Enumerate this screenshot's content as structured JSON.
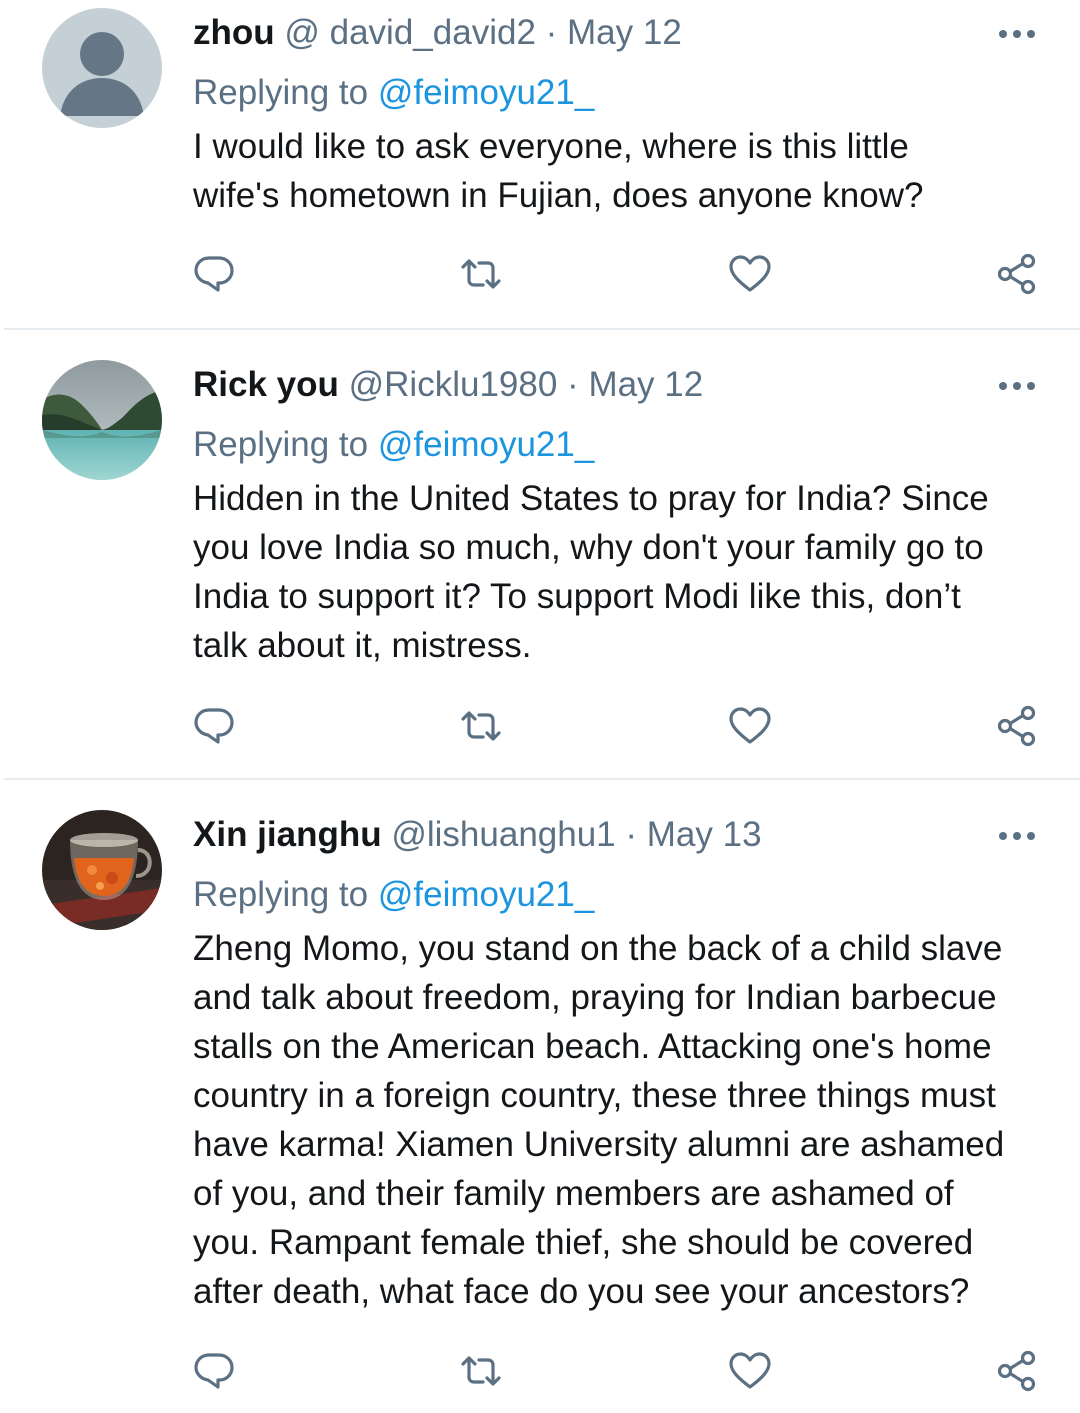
{
  "colors": {
    "name": "#14171a",
    "secondary": "#5b7083",
    "link": "#1b95e0",
    "divider": "#e6ecf0"
  },
  "tweets": [
    {
      "name": "zhou",
      "handle": "@ david_david2",
      "separator": "·",
      "date": "May 12",
      "replying_prefix": "Replying to",
      "replying_to": "@feimoyu21_",
      "text_lines": [
        "I would like to ask everyone, where is this little",
        "wife's hometown in Fujian, does anyone know?"
      ],
      "avatar": "default-avatar",
      "icons": [
        "reply-icon",
        "retweet-icon",
        "like-icon",
        "share-icon",
        "more-icon"
      ]
    },
    {
      "name": "Rick you",
      "handle": "@Ricklu1980",
      "separator": "·",
      "date": "May 12",
      "replying_prefix": "Replying to",
      "replying_to": "@feimoyu21_",
      "text_lines": [
        "Hidden in the United States to pray for India? Since",
        "you love India so much, why don't your family go to",
        "India to support it? To support Modi like this, don’t",
        "talk about it, mistress."
      ],
      "avatar": "lake-mountain-photo",
      "icons": [
        "reply-icon",
        "retweet-icon",
        "like-icon",
        "share-icon",
        "more-icon"
      ]
    },
    {
      "name": "Xin jianghu",
      "handle": "@lishuanghu1",
      "separator": "·",
      "date": "May 13",
      "replying_prefix": "Replying to",
      "replying_to": "@feimoyu21_",
      "text_lines": [
        "Zheng Momo, you stand on the back of a child slave",
        "and talk about freedom, praying for Indian barbecue",
        "stalls on the American beach. Attacking one's home",
        "country in a foreign country, these three things must",
        "have karma! Xiamen University alumni are ashamed",
        "of you, and their family members are ashamed of",
        "you. Rampant female thief, she should be covered",
        "after death, what face do you see your ancestors?"
      ],
      "avatar": "glass-tea-cup-photo",
      "icons": [
        "reply-icon",
        "retweet-icon",
        "like-icon",
        "share-icon",
        "more-icon"
      ]
    }
  ]
}
